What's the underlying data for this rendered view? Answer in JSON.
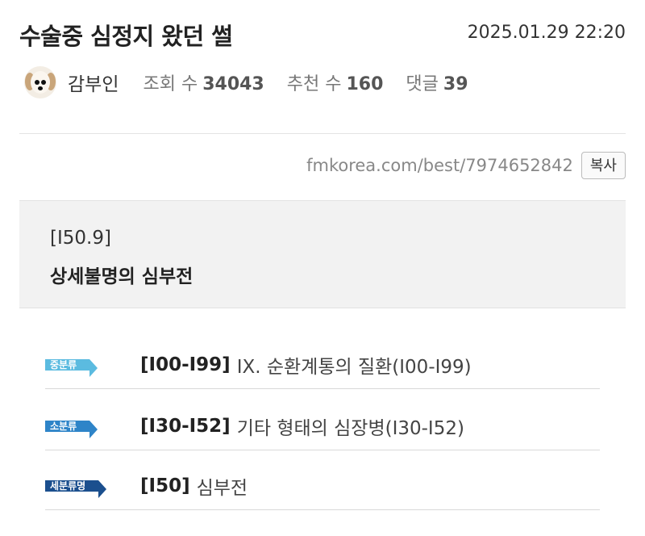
{
  "post": {
    "title": "수술중 심정지 왔던 썰",
    "date": "2025.01.29 22:20",
    "author": "감부인",
    "views_label": "조회 수",
    "views": "34043",
    "recommend_label": "추천 수",
    "recommend": "160",
    "comments_label": "댓글",
    "comments": "39",
    "avatar_icon": "puppy-avatar-icon"
  },
  "share": {
    "url": "fmkorea.com/best/7974652842",
    "copy_label": "복사"
  },
  "code": {
    "id": "[I50.9]",
    "name": "상세불명의 심부전"
  },
  "classifications": [
    {
      "badge": "중분류",
      "badge_color": "#5bbbe0",
      "code": "[I00-I99]",
      "text": "IX. 순환계통의 질환(I00-I99)"
    },
    {
      "badge": "소분류",
      "badge_color": "#2e84c8",
      "code": "[I30-I52]",
      "text": "기타 형태의 심장병(I30-I52)"
    },
    {
      "badge": "세분류명",
      "badge_color": "#1b4f8e",
      "code": "[I50]",
      "text": "심부전"
    }
  ]
}
